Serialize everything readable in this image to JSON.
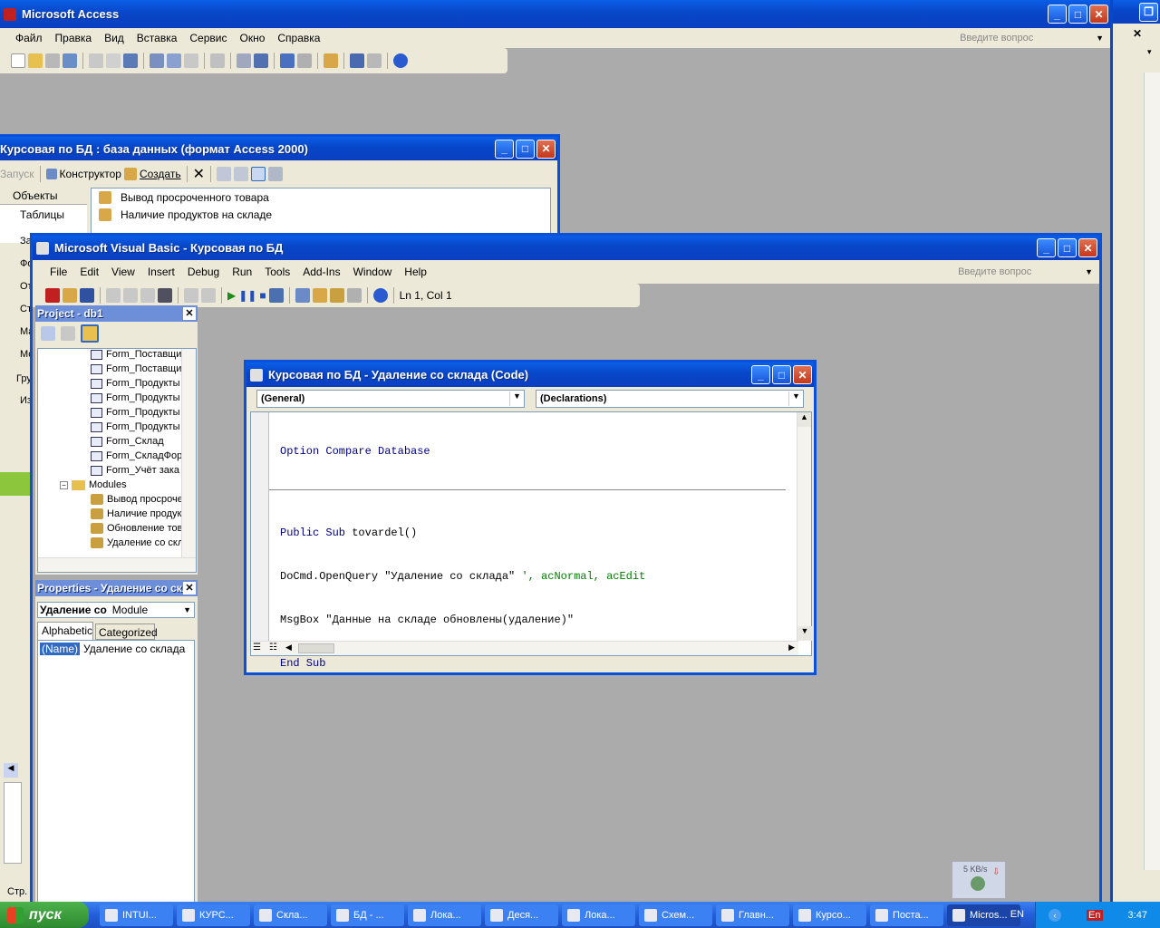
{
  "access": {
    "title": "Microsoft Access",
    "menu": [
      "Файл",
      "Правка",
      "Вид",
      "Вставка",
      "Сервис",
      "Окно",
      "Справка"
    ],
    "ask_placeholder": "Введите вопрос"
  },
  "db_window": {
    "title": "Курсовая по БД : база данных (формат Access 2000)",
    "toolbar": {
      "run": "Запуск",
      "design": "Конструктор",
      "create": "Создать"
    },
    "objects_header": "Объекты",
    "objects": [
      "Таблицы",
      "За",
      "Фо",
      "От",
      "Ст",
      "Ма",
      "Мо"
    ],
    "groups_header": "Гру",
    "groups_item": "Из",
    "items": [
      "Вывод просроченного товара",
      "Наличие продуктов на складе"
    ]
  },
  "vb": {
    "title": "Microsoft Visual Basic - Курсовая по БД",
    "menu": [
      "File",
      "Edit",
      "View",
      "Insert",
      "Debug",
      "Run",
      "Tools",
      "Add-Ins",
      "Window",
      "Help"
    ],
    "ask_placeholder": "Введите вопрос",
    "position": "Ln 1, Col 1",
    "project": {
      "title": "Project - db1",
      "items": [
        "Form_Поставщи",
        "Form_Поставщи",
        "Form_Продукты",
        "Form_Продукты",
        "Form_Продукты",
        "Form_Продукты",
        "Form_Склад",
        "Form_СкладФор",
        "Form_Учёт зака"
      ],
      "modules_label": "Modules",
      "modules": [
        "Вывод просроче",
        "Наличие продук",
        "Обновление тов",
        "Удаление со скл"
      ]
    },
    "properties": {
      "title": "Properties - Удаление со скл",
      "object_name": "Удаление со",
      "object_type": "Module",
      "tab_alpha": "Alphabetic",
      "tab_cat": "Categorized",
      "prop_name": "(Name)",
      "prop_value": "Удаление со склада"
    }
  },
  "code_window": {
    "title": "Курсовая по БД - Удаление со склада (Code)",
    "object_dd": "(General)",
    "proc_dd": "(Declarations)",
    "line1": "Option Compare Database",
    "line2_kw": "Public Sub",
    "line2_rest": " tovardel()",
    "line3_code": "DoCmd.OpenQuery \"Удаление со склада\" ",
    "line3_comment": "', acNormal, acEdit",
    "line4_kw": "MsgBox",
    "line4_rest": " \"Данные на складе обновлены(удаление)\"",
    "line5": "End Sub"
  },
  "netmeter": {
    "speed": "5 KB/s"
  },
  "taskbar": {
    "start": "пуск",
    "tasks": [
      "INTUI...",
      "КУРС...",
      "Скла...",
      "БД - ...",
      "Лока...",
      "Деся...",
      "Лока...",
      "Схем...",
      "Главн...",
      "Курсо...",
      "Поста...",
      "Micros..."
    ],
    "lang": "EN",
    "lang2": "En",
    "clock": "3:47"
  },
  "side": {
    "status": "Стр."
  },
  "colors": {
    "xp_blue": "#0a50d8",
    "taskbar": "#245edb",
    "start": "#3c9a3c",
    "keyword": "#000080",
    "comment": "#008000"
  }
}
